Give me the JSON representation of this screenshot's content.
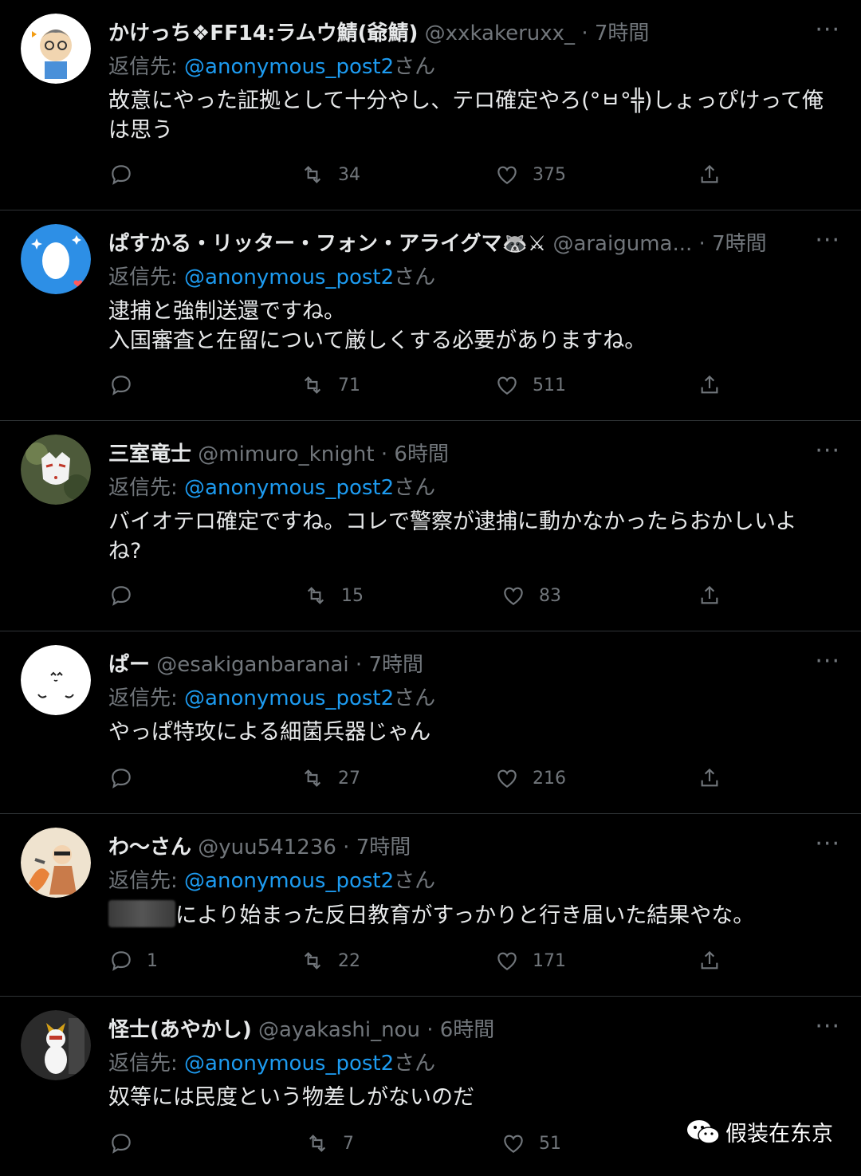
{
  "reply_prefix": "返信先:",
  "reply_suffix": "さん",
  "tweets": [
    {
      "name": "かけっち❖FF14:ラムウ鯖(爺鯖)",
      "handle": "@xxkakeruxx_",
      "time": "7時間",
      "reply_to": "@anonymous_post2",
      "text_lines": [
        "故意にやった証拠として十分やし、テロ確定やろ(°ㅂ°╬)しょっぴけって俺",
        "は思う"
      ],
      "replies": "",
      "retweets": "34",
      "likes": "375"
    },
    {
      "name": "ぱすかる・リッター・フォン・アライグマ🦝⚔",
      "handle": "@araiguma...",
      "time": "7時間",
      "reply_to": "@anonymous_post2",
      "text_lines": [
        "逮捕と強制送還ですね。",
        "入国審査と在留について厳しくする必要がありますね。"
      ],
      "replies": "",
      "retweets": "71",
      "likes": "511"
    },
    {
      "name": "三室竜士",
      "handle": "@mimuro_knight",
      "time": "6時間",
      "reply_to": "@anonymous_post2",
      "text_lines": [
        "バイオテロ確定ですね。コレで警察が逮捕に動かなかったらおかしいよ",
        "ね?"
      ],
      "replies": "",
      "retweets": "15",
      "likes": "83"
    },
    {
      "name": "ぱー",
      "handle": "@esakiganbaranai",
      "time": "7時間",
      "reply_to": "@anonymous_post2",
      "text_lines": [
        "やっぱ特攻による細菌兵器じゃん"
      ],
      "replies": "",
      "retweets": "27",
      "likes": "216"
    },
    {
      "name": "わ～さん",
      "handle": "@yuu541236",
      "time": "7時間",
      "reply_to": "@anonymous_post2",
      "text_lines": [
        "により始まった反日教育がすっかりと行き届いた結果やな。"
      ],
      "replies": "1",
      "retweets": "22",
      "likes": "171"
    },
    {
      "name": "怪士(あやかし)",
      "handle": "@ayakashi_nou",
      "time": "6時間",
      "reply_to": "@anonymous_post2",
      "text_lines": [
        "奴等には民度という物差しがないのだ"
      ],
      "replies": "",
      "retweets": "7",
      "likes": "51"
    }
  ],
  "dot_separator": "·",
  "more_label": "···",
  "watermark": "假装在东京",
  "icons": {
    "reply": "reply-icon",
    "retweet": "retweet-icon",
    "like": "like-icon",
    "share": "share-icon",
    "more": "more-icon"
  }
}
